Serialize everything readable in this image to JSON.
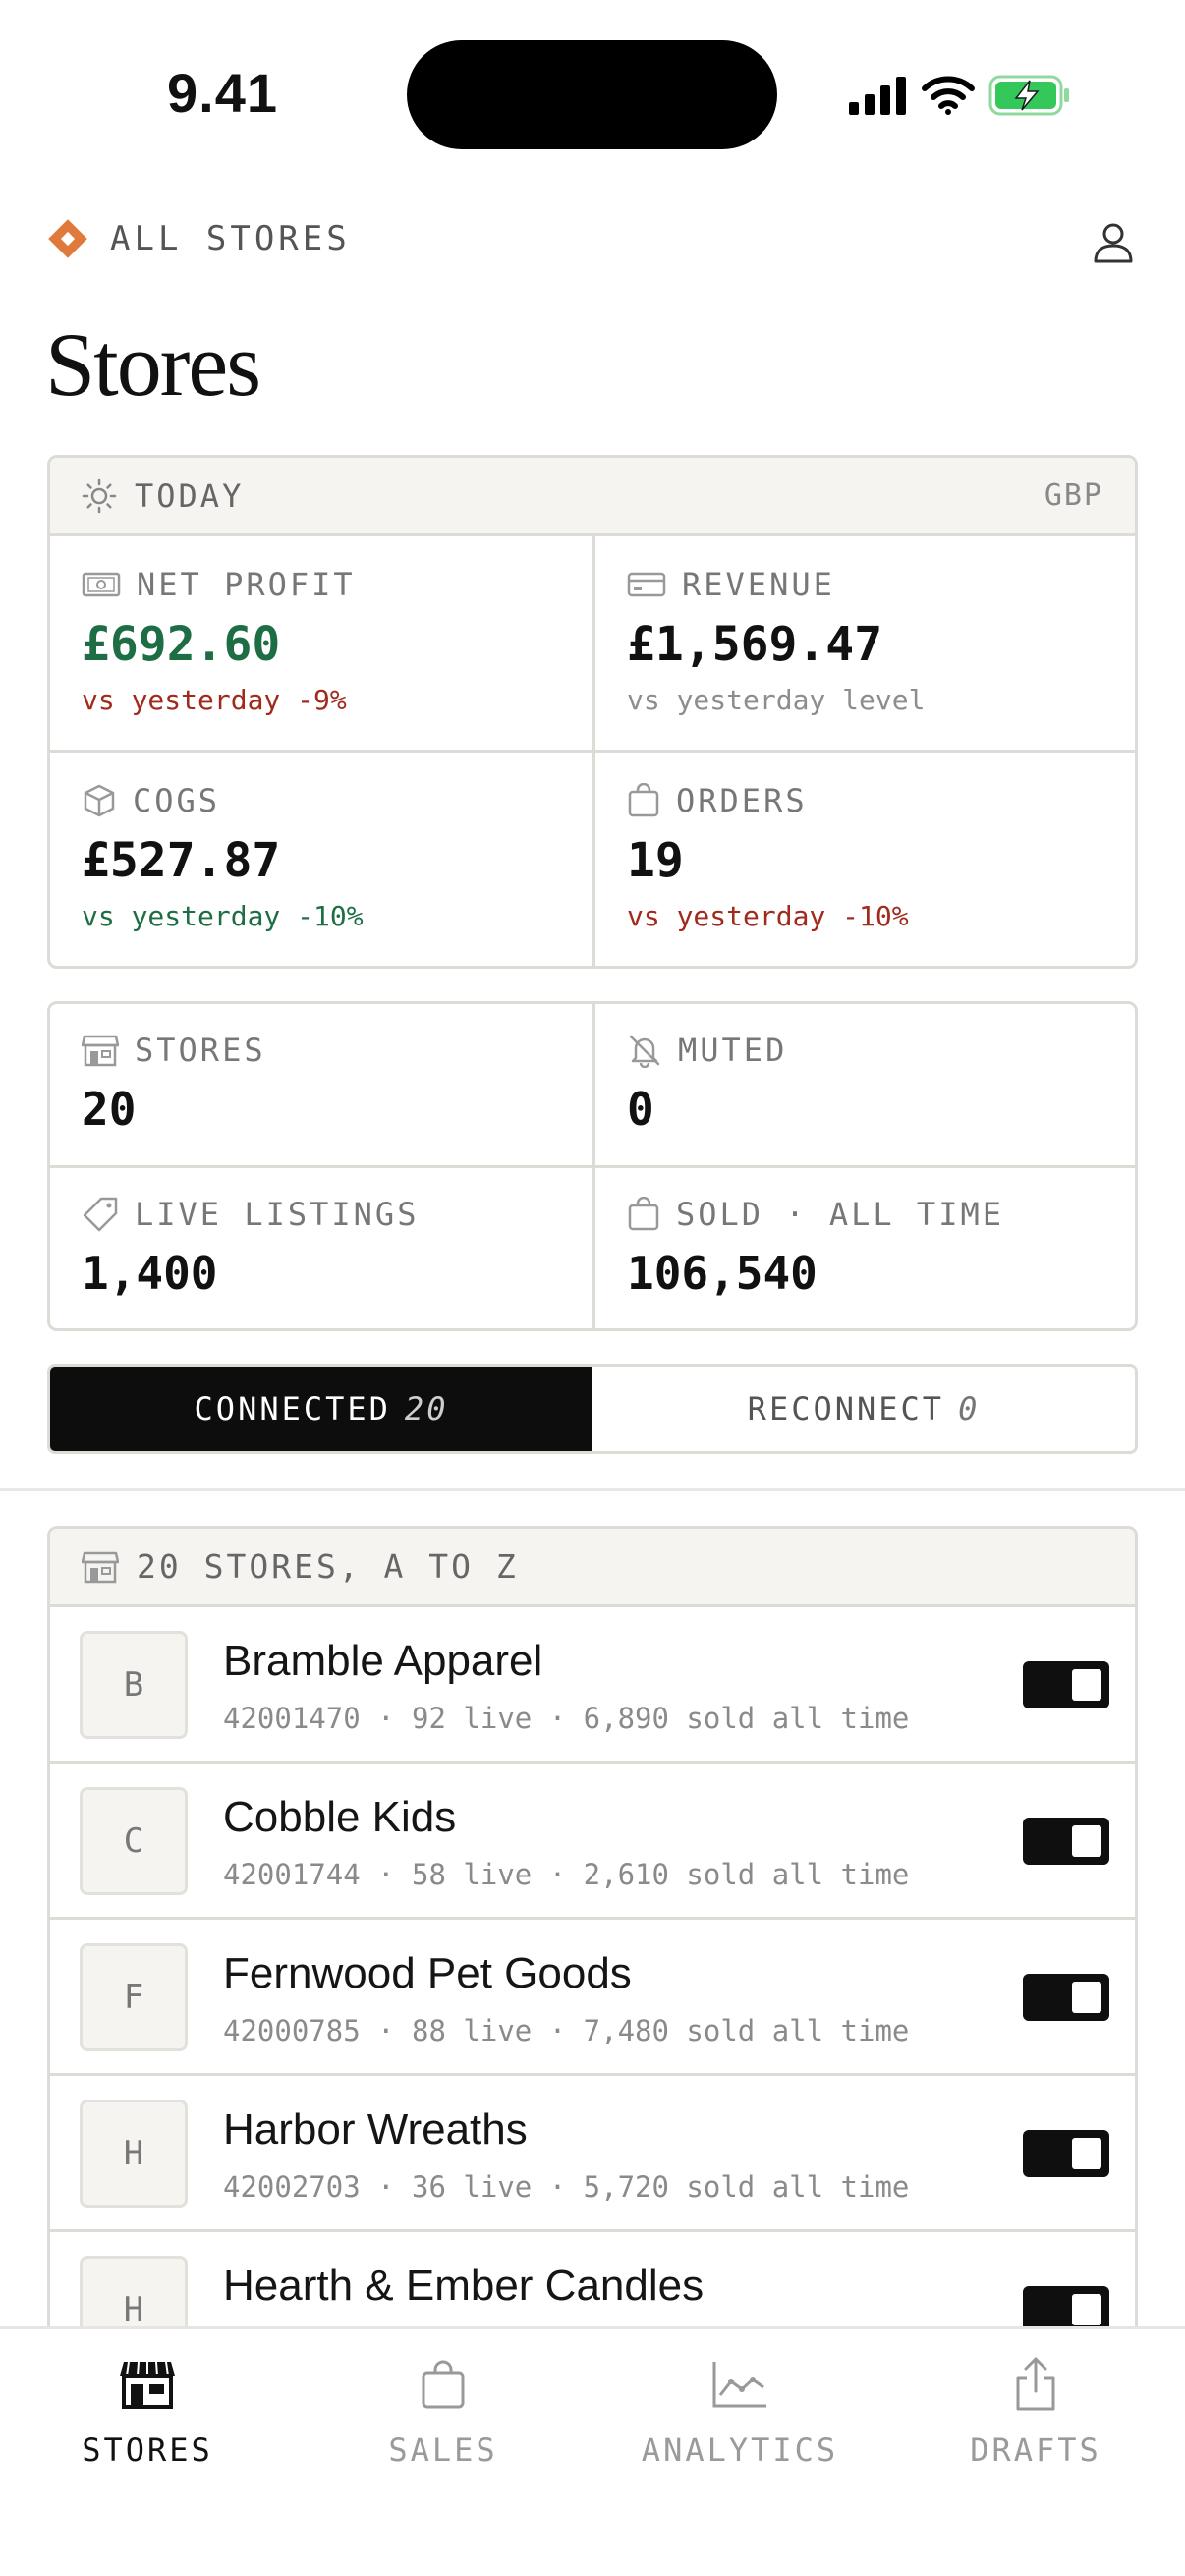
{
  "status_bar": {
    "time": "9.41"
  },
  "header": {
    "breadcrumb": "ALL STORES",
    "title": "Stores"
  },
  "today": {
    "label": "TODAY",
    "currency": "GBP",
    "net_profit": {
      "label": "NET PROFIT",
      "value": "£692.60",
      "delta": "vs yesterday -9%"
    },
    "revenue": {
      "label": "REVENUE",
      "value": "£1,569.47",
      "delta": "vs yesterday level"
    },
    "cogs": {
      "label": "COGS",
      "value": "£527.87",
      "delta": "vs yesterday -10%"
    },
    "orders": {
      "label": "ORDERS",
      "value": "19",
      "delta": "vs yesterday -10%"
    }
  },
  "summary": {
    "stores": {
      "label": "STORES",
      "value": "20"
    },
    "muted": {
      "label": "MUTED",
      "value": "0"
    },
    "live_listings": {
      "label": "LIVE LISTINGS",
      "value": "1,400"
    },
    "sold": {
      "label": "SOLD · ALL TIME",
      "value": "106,540"
    }
  },
  "segments": {
    "connected": {
      "label": "CONNECTED",
      "count": "20"
    },
    "reconnect": {
      "label": "RECONNECT",
      "count": "0"
    }
  },
  "store_list": {
    "header": "20 STORES, A TO Z",
    "items": [
      {
        "initial": "B",
        "name": "Bramble Apparel",
        "meta": "42001470 · 92 live · 6,890 sold all time",
        "enabled": true
      },
      {
        "initial": "C",
        "name": "Cobble Kids",
        "meta": "42001744 · 58 live · 2,610 sold all time",
        "enabled": true
      },
      {
        "initial": "F",
        "name": "Fernwood Pet Goods",
        "meta": "42000785 · 88 live · 7,480 sold all time",
        "enabled": true
      },
      {
        "initial": "H",
        "name": "Harbor Wreaths",
        "meta": "42002703 · 36 live · 5,720 sold all time",
        "enabled": true
      },
      {
        "initial": "H",
        "name": "Hearth & Ember Candles",
        "meta": "",
        "enabled": true
      }
    ]
  },
  "tabbar": {
    "stores": "STORES",
    "sales": "SALES",
    "analytics": "ANALYTICS",
    "drafts": "DRAFTS"
  },
  "colors": {
    "accent": "#e07a3c",
    "positive": "#1e6e45",
    "negative": "#a02a1c",
    "battery": "#34c759"
  }
}
